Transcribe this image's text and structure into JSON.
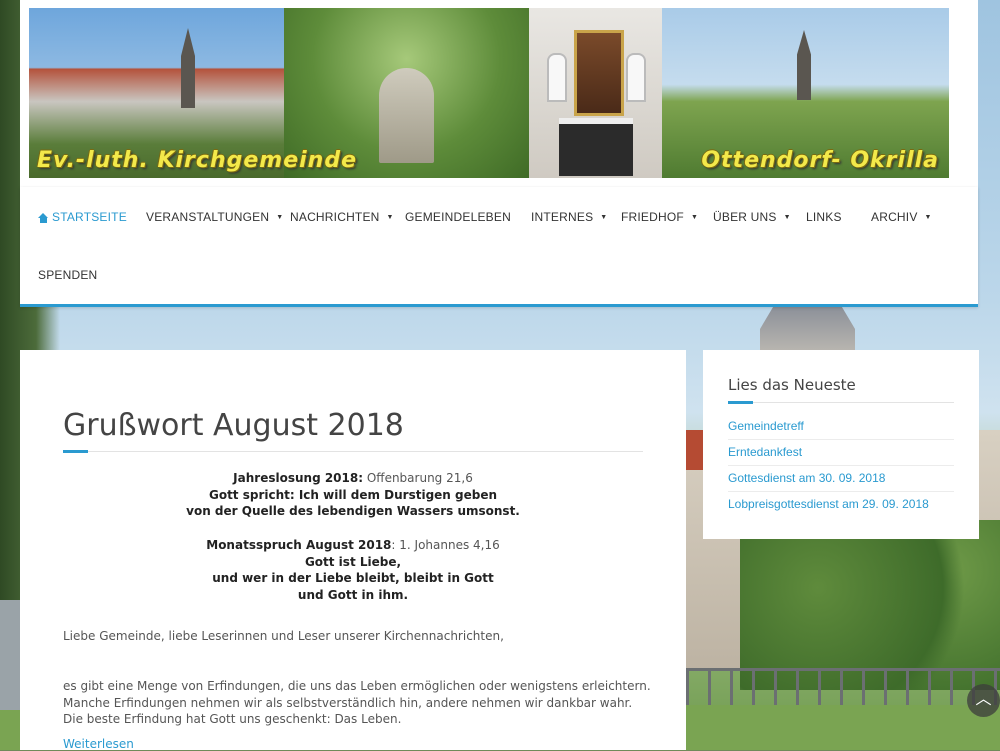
{
  "header": {
    "title_left": "Ev.-luth. Kirchgemeinde",
    "title_right": "Ottendorf- Okrilla"
  },
  "nav": {
    "items": [
      {
        "label": "Startseite",
        "active": true,
        "dropdown": false
      },
      {
        "label": "Veranstaltungen",
        "dropdown": true
      },
      {
        "label": "Nachrichten",
        "dropdown": true
      },
      {
        "label": "Gemeindeleben",
        "dropdown": false
      },
      {
        "label": "Internes",
        "dropdown": true
      },
      {
        "label": "Friedhof",
        "dropdown": true
      },
      {
        "label": "Über uns",
        "dropdown": true
      },
      {
        "label": "Links",
        "dropdown": false
      },
      {
        "label": "Archiv",
        "dropdown": true
      },
      {
        "label": "Spenden",
        "dropdown": false
      }
    ],
    "home_icon": "home-icon",
    "dropdown_icon": "caret-down-icon"
  },
  "post": {
    "title": "Grußwort August 2018",
    "losung_label": "Jahreslosung 2018:",
    "losung_ref": "Offenbarung 21,6",
    "losung_line1": "Gott spricht: Ich will dem Durstigen geben",
    "losung_line2": "von der Quelle des lebendigen Wassers umsonst.",
    "spruch_label": "Monatsspruch August 2018",
    "spruch_ref": ": 1. Johannes 4,16",
    "spruch_line1": "Gott ist Liebe,",
    "spruch_line2": "und wer in der Liebe bleibt, bleibt in Gott",
    "spruch_line3": "und Gott in ihm.",
    "greeting": "Liebe Gemeinde, liebe Leserinnen und Leser unserer Kirchennachrichten,",
    "para1": "es gibt eine Menge von Erfindungen, die uns das Leben ermöglichen oder wenigstens erleichtern. Manche Erfindungen nehmen wir als selbstverständlich hin, andere nehmen wir dankbar wahr.",
    "para2": "Die beste Erfindung hat Gott uns geschenkt: Das Leben.",
    "read_more": "Weiterlesen"
  },
  "sidebar": {
    "title": "Lies das Neueste",
    "links": [
      "Gemeindetreff",
      "Erntedankfest",
      "Gottesdienst am 30. 09. 2018",
      "Lobpreisgottesdienst am 29. 09. 2018"
    ]
  },
  "back_to_top_icon": "chevron-up-icon",
  "colors": {
    "accent": "#2a9ad0",
    "banner_text": "#f3e94a"
  }
}
